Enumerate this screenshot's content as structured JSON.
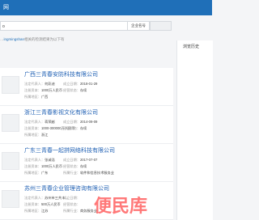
{
  "header": {
    "title": "网"
  },
  "search": {
    "query": "o",
    "type_label": "企业名号"
  },
  "hint": {
    "prefix": "…",
    "keyword": "ingmingshan",
    "suffix": "相关的检测结果为以下有"
  },
  "sidebar": {
    "title": "浏览历史"
  },
  "companies": [
    {
      "name": "广西三青春安防科技有限公司",
      "legal_label": "法定代表人：",
      "legal": "何彩迪",
      "date_label": "成立日期：",
      "date": "2018-01-29",
      "capital_label": "注册资本：",
      "capital": "1000万人民币",
      "status_label": "经营状态：",
      "status": "存续",
      "region_label": "所属地区：",
      "region": "广西"
    },
    {
      "name": "浙江三青春影视文化有限公司",
      "legal_label": "法定代表人：",
      "legal": "蒋荣越",
      "date_label": "成立日期：",
      "date": "2014-09-09",
      "capital_label": "注册资本：",
      "capital": "1000-300000万人民币",
      "status_label": "经营状态：",
      "status": "存续",
      "region_label": "所属地区：",
      "region": "浙江"
    },
    {
      "name": "广东三青春一起拼网络科技有限公司",
      "legal_label": "法定代表人：",
      "legal": "张诚浩",
      "date_label": "成立日期：",
      "date": "2017-07-07",
      "capital_label": "注册资本：",
      "capital": "1000万人民币",
      "status_label": "经营状态：",
      "status": "存续",
      "region_label": "所属地区：",
      "region": "广东",
      "industry_label": "所属行业：",
      "industry": "软件和信息技术服务业"
    },
    {
      "name": "苏州三青春企业管理咨询有限公司",
      "legal_label": "法定代表人：",
      "legal": "苏州市三共丰…",
      "date_label": "成立日期：",
      "date": "",
      "capital_label": "注册资本：",
      "capital": "500万人民币",
      "status_label": "经营状态：",
      "status": "",
      "region_label": "所属地区：",
      "region": "江苏",
      "industry_label": "所属行业：",
      "industry": "商务服务业"
    }
  ],
  "watermark": {
    "text": "便民库"
  }
}
